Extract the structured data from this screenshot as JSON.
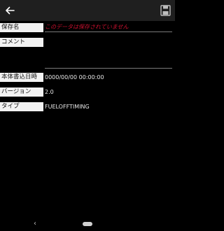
{
  "toolbar": {
    "back_icon": "arrow-left-icon",
    "save_icon": "floppy-disk-icon"
  },
  "form": {
    "name": {
      "label": "保存名",
      "placeholder": "このデータは保存されていません"
    },
    "comment": {
      "label": "コメント",
      "value": ""
    },
    "written_datetime": {
      "label": "本体書込日時",
      "value": "0000/00/00 00:00:00"
    },
    "version": {
      "label": "バージョン",
      "value": "2.0"
    },
    "type": {
      "label": "タイプ",
      "value": "FUELOFFTIMING"
    }
  },
  "navigation": {
    "back_glyph": "‹"
  },
  "colors": {
    "placeholder": "#c8102e",
    "appbar": "#1f1f1f",
    "label_bg": "#f2f2f2"
  }
}
